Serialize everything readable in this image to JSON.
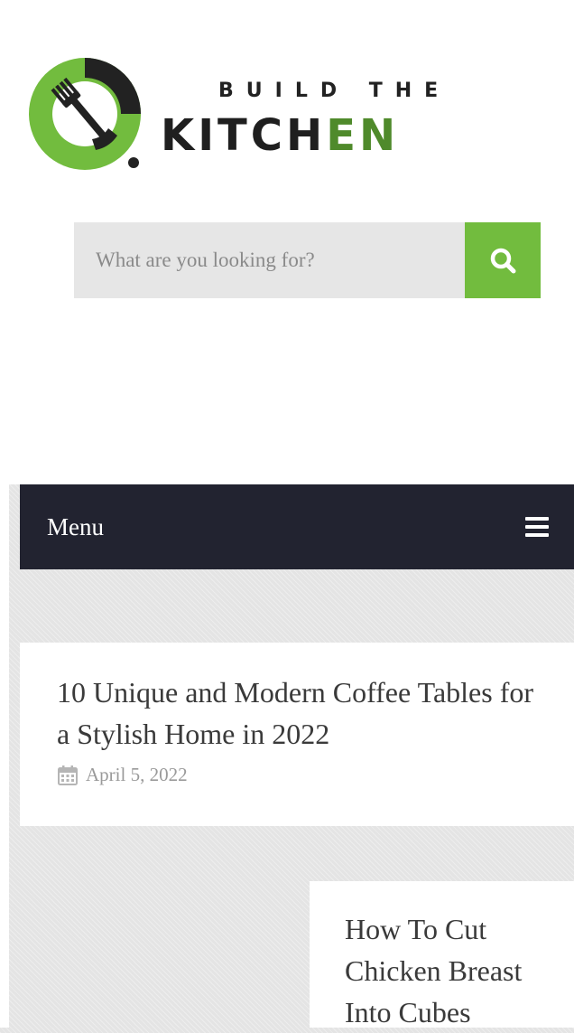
{
  "logo": {
    "line1": "BUILD THE",
    "line2_dark": "KITCH",
    "line2_green": "EN",
    "icon": "fork-knife-ring-icon",
    "colors": {
      "green": "#72bc3e",
      "dark": "#1f1f1f",
      "dark_green": "#4f8a2b"
    }
  },
  "search": {
    "placeholder": "What are you looking for?",
    "value": "",
    "button_icon": "search-icon",
    "button_color": "#72bc3e"
  },
  "nav": {
    "menu_label": "Menu",
    "menu_icon": "hamburger-icon",
    "background": "#222330"
  },
  "posts": [
    {
      "title": "10 Unique and Modern Coffee Tables for a Stylish Home in 2022",
      "date": "April 5, 2022",
      "date_icon": "calendar-icon"
    },
    {
      "title": "How To Cut Chicken Breast Into Cubes"
    }
  ]
}
